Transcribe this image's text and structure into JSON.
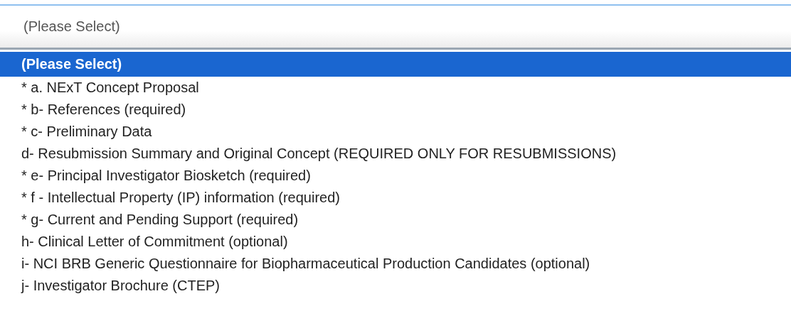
{
  "select": {
    "value": "(Please Select)",
    "options": [
      {
        "label": "(Please Select)",
        "selected": true
      },
      {
        "label": "* a. NExT Concept Proposal",
        "selected": false
      },
      {
        "label": "* b- References (required)",
        "selected": false
      },
      {
        "label": "* c- Preliminary Data",
        "selected": false
      },
      {
        "label": "d- Resubmission Summary and Original Concept (REQUIRED ONLY FOR RESUBMISSIONS)",
        "selected": false
      },
      {
        "label": "* e- Principal Investigator Biosketch (required)",
        "selected": false
      },
      {
        "label": "* f - Intellectual Property (IP) information (required)",
        "selected": false
      },
      {
        "label": "* g- Current and Pending Support (required)",
        "selected": false
      },
      {
        "label": "h- Clinical Letter of Commitment (optional)",
        "selected": false
      },
      {
        "label": "i- NCI BRB Generic Questionnaire for Biopharmaceutical Production Candidates (optional)",
        "selected": false
      },
      {
        "label": "j- Investigator Brochure (CTEP)",
        "selected": false
      }
    ]
  }
}
